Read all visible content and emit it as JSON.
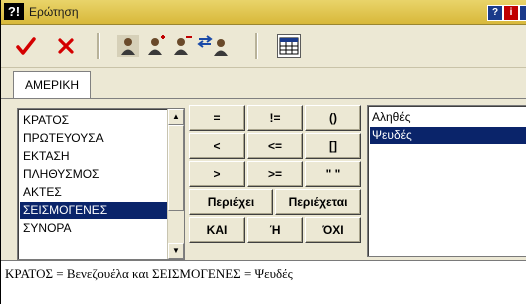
{
  "window": {
    "icon_text": "?!",
    "title": "Ερώτηση"
  },
  "titlebar_buttons": [
    "?",
    "i",
    ""
  ],
  "toolbar": {
    "ok_icon": "checkmark-icon",
    "cancel_icon": "cross-icon",
    "grid_icon": "grid-table-icon"
  },
  "tabs": [
    {
      "label": "ΑΜΕΡΙΚΗ"
    }
  ],
  "fields": {
    "items": [
      "ΚΡΑΤΟΣ",
      "ΠΡΩΤΕΥΟΥΣΑ",
      "ΕΚΤΑΣΗ",
      "ΠΛΗΘΥΣΜΟΣ",
      "ΑΚΤΕΣ",
      "ΣΕΙΣΜΟΓΕΝΕΣ",
      "ΣΥΝΟΡΑ"
    ],
    "selected": "ΣΕΙΣΜΟΓΕΝΕΣ"
  },
  "operators": {
    "eq": "=",
    "neq": "!=",
    "parens": "()",
    "lt": "<",
    "lte": "<=",
    "brackets": "[]",
    "gt": ">",
    "gte": ">=",
    "quotes": "\" \"",
    "contains": "Περιέχει",
    "contained": "Περιέχεται",
    "and": "ΚΑΙ",
    "or": "Ή",
    "not": "ΌΧΙ"
  },
  "values": {
    "items": [
      "Αληθές",
      "Ψευδές"
    ],
    "selected": "Ψευδές"
  },
  "query_text": "ΚΡΑΤΟΣ = Βενεζουέλα και ΣΕΙΣΜΟΓΕΝΕΣ = Ψευδές",
  "colors": {
    "titlebar": "#d8b83a",
    "selection": "#0a246a",
    "ok": "#d40000",
    "cancel": "#d40000"
  }
}
